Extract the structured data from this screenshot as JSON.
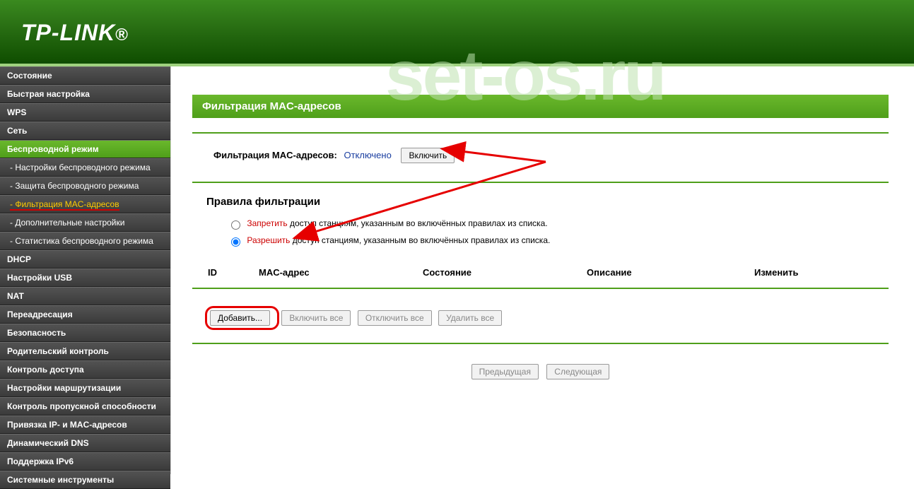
{
  "brand": "TP-LINK",
  "watermark": "set-os.ru",
  "sidebar": {
    "items": [
      {
        "label": "Состояние",
        "type": "top"
      },
      {
        "label": "Быстрая настройка",
        "type": "top"
      },
      {
        "label": "WPS",
        "type": "top"
      },
      {
        "label": "Сеть",
        "type": "top"
      },
      {
        "label": "Беспроводной режим",
        "type": "top",
        "active": true
      },
      {
        "label": "- Настройки беспроводного режима",
        "type": "sub"
      },
      {
        "label": "- Защита беспроводного режима",
        "type": "sub"
      },
      {
        "label": "- Фильтрация MAC-адресов",
        "type": "sub",
        "selected": true
      },
      {
        "label": "- Дополнительные настройки",
        "type": "sub"
      },
      {
        "label": "- Статистика беспроводного режима",
        "type": "sub"
      },
      {
        "label": "DHCP",
        "type": "top"
      },
      {
        "label": "Настройки USB",
        "type": "top"
      },
      {
        "label": "NAT",
        "type": "top"
      },
      {
        "label": "Переадресация",
        "type": "top"
      },
      {
        "label": "Безопасность",
        "type": "top"
      },
      {
        "label": "Родительский контроль",
        "type": "top"
      },
      {
        "label": "Контроль доступа",
        "type": "top"
      },
      {
        "label": "Настройки маршрутизации",
        "type": "top"
      },
      {
        "label": "Контроль пропускной способности",
        "type": "top"
      },
      {
        "label": "Привязка IP- и MAC-адресов",
        "type": "top"
      },
      {
        "label": "Динамический DNS",
        "type": "top"
      },
      {
        "label": "Поддержка IPv6",
        "type": "top"
      },
      {
        "label": "Системные инструменты",
        "type": "top"
      }
    ]
  },
  "page": {
    "title": "Фильтрация MAC-адресов",
    "status_label": "Фильтрация MAC-адресов:",
    "status_value": "Отключено",
    "enable_btn": "Включить",
    "rules_heading": "Правила фильтрации",
    "deny_word": "Запретить",
    "deny_rest": " доступ станциям, указанным во включённых правилах из списка.",
    "allow_word": "Разрешить",
    "allow_rest": " доступ станциям, указанным во включённых правилах из списка.",
    "columns": {
      "id": "ID",
      "mac": "MAC-адрес",
      "state": "Состояние",
      "desc": "Описание",
      "edit": "Изменить"
    },
    "buttons": {
      "add": "Добавить...",
      "enable_all": "Включить все",
      "disable_all": "Отключить все",
      "delete_all": "Удалить все",
      "prev": "Предыдущая",
      "next": "Следующая"
    }
  }
}
